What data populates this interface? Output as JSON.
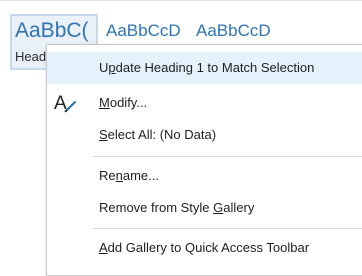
{
  "gallery": {
    "styles": [
      {
        "preview": "AaBbC(",
        "name": "Head"
      },
      {
        "preview": "AaBbCcD",
        "name": ""
      },
      {
        "preview": "AaBbCcD",
        "name": ""
      }
    ]
  },
  "context_menu": {
    "items": [
      {
        "label": "Update Heading 1 to Match Selection",
        "access_key": "p"
      },
      {
        "label": "Modify...",
        "icon": "modify-style-icon",
        "access_key": "M"
      },
      {
        "label": "Select All: (No Data)",
        "access_key": "S"
      },
      {
        "label": "Rename...",
        "access_key": "n"
      },
      {
        "label": "Remove from Style Gallery",
        "access_key": "G"
      },
      {
        "label": "Add Gallery to Quick Access Toolbar",
        "access_key": "A"
      }
    ]
  },
  "colors": {
    "style_preview": "#2e74b5",
    "selected_tile_bg": "#e9f0f8",
    "highlight_bg": "#e5f1fb"
  }
}
